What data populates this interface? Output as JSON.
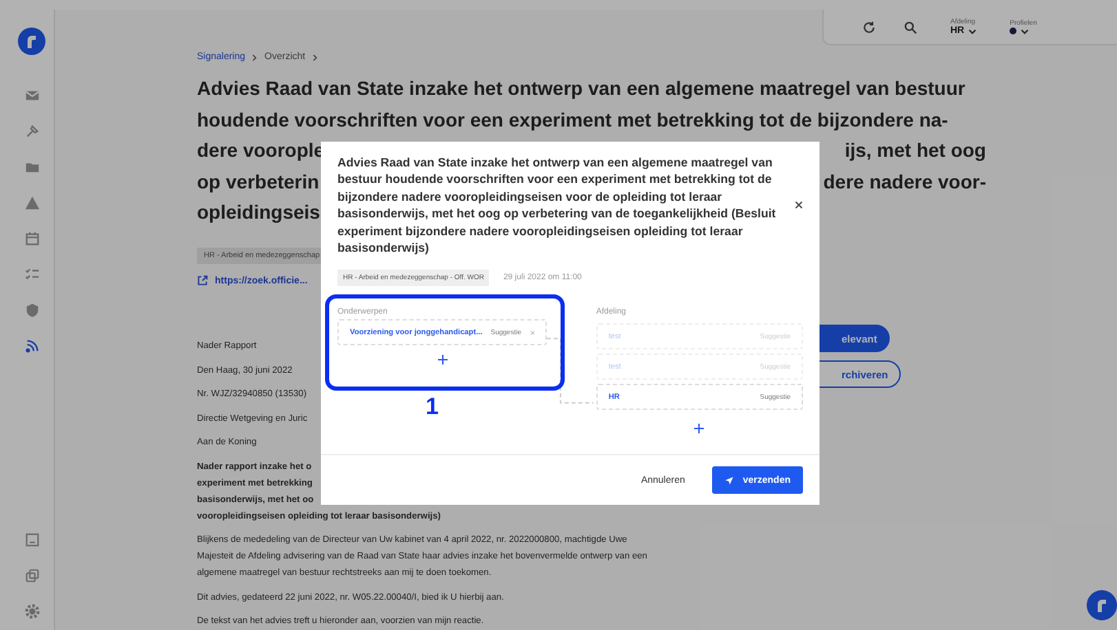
{
  "header": {
    "department": {
      "label": "Afdeling",
      "value": "HR"
    },
    "profile": {
      "label": "Profielen"
    }
  },
  "sidebar": {
    "items": [
      {
        "selected": false
      },
      {
        "selected": false
      },
      {
        "selected": false
      },
      {
        "selected": false
      },
      {
        "selected": false
      },
      {
        "selected": false
      },
      {
        "selected": false
      },
      {
        "selected": true
      }
    ]
  },
  "breadcrumb": [
    {
      "label": "Signalering",
      "kind": "link"
    },
    {
      "label": "Overzicht",
      "kind": "current"
    }
  ],
  "document": {
    "title_lines": [
      {
        "left": "Advies Raad van State inzake het ontwerp van een algemene maatregel van bestuur"
      },
      {
        "left": "houdende voorschriften voor een experiment met betrekking tot de bijzondere na-"
      },
      {
        "left": "dere voorople",
        "right": "ijs, met het oog"
      },
      {
        "left": "op verbeterin",
        "right": "dere nadere voor-"
      },
      {
        "left": "opleidingseis"
      }
    ],
    "tag": "HR - Arbeid en medezeggenschap",
    "link": "https://zoek.officie...",
    "paragraphs": [
      {
        "kind": "normal",
        "lines": [
          "Nader Rapport"
        ]
      },
      {
        "kind": "normal",
        "lines": [
          "Den Haag, 30 juni 2022"
        ]
      },
      {
        "kind": "normal",
        "lines": [
          "Nr. WJZ/32940850 (13530)"
        ]
      },
      {
        "kind": "normal",
        "lines": [
          "Directie Wetgeving en Juric"
        ]
      },
      {
        "kind": "normal",
        "lines": [
          "Aan de Koning"
        ]
      },
      {
        "kind": "bold",
        "lines": [
          "Nader rapport inzake het o",
          "experiment met betrekking",
          "basisonderwijs, met het oo",
          "vooropleidingseisen opleiding tot leraar basisonderwijs)"
        ]
      },
      {
        "kind": "normal",
        "lines": [
          "Blijkens de mededeling van de Directeur van Uw kabinet van 4 april 2022, nr. 2022000800, machtigde Uwe",
          "Majesteit de Afdeling advisering van de Raad van State haar advies inzake het bovenvermelde ontwerp van een",
          "algemene maatregel van bestuur rechtstreeks aan mij te doen toekomen."
        ]
      },
      {
        "kind": "normal",
        "lines": [
          "Dit advies, gedateerd 22 juni 2022, nr. W05.22.00040/I, bied ik U hierbij aan."
        ]
      },
      {
        "kind": "normal",
        "lines": [
          "De tekst van het advies treft u hieronder aan, voorzien van mijn reactie."
        ]
      }
    ],
    "actions": [
      {
        "label": "elevant",
        "kind": "primary"
      },
      {
        "label": "rchiveren",
        "kind": "outline"
      }
    ]
  },
  "dialog": {
    "title": "Advies Raad van State inzake het ontwerp van een algemene maatregel van bestuur houdende voorschriften voor een experiment met betrekking tot de bijzondere nadere vooropleidingseisen voor de opleiding tot leraar basisonderwijs, met het oog op verbetering van de toegankelijkheid (Besluit experiment bijzondere nadere vooropleidingseisen opleiding tot leraar basisonderwijs)",
    "tag": "HR - Arbeid en medezeggenschap - Off. WOR",
    "date": "29 juli 2022 om 11:00",
    "subjects": {
      "label": "Onderwerpen",
      "items": [
        {
          "name": "Voorziening voor jonggehandicapt...",
          "badge": "Suggestie"
        }
      ]
    },
    "departments": {
      "label": "Afdeling",
      "items": [
        {
          "name": "test",
          "badge": "Suggestie",
          "faded": true
        },
        {
          "name": "test",
          "badge": "Suggestie",
          "faded": true
        },
        {
          "name": "HR",
          "badge": "Suggestie",
          "faded": false
        }
      ]
    },
    "cancel": "Annuleren",
    "submit": "verzenden"
  },
  "annotation": {
    "label": "1"
  }
}
